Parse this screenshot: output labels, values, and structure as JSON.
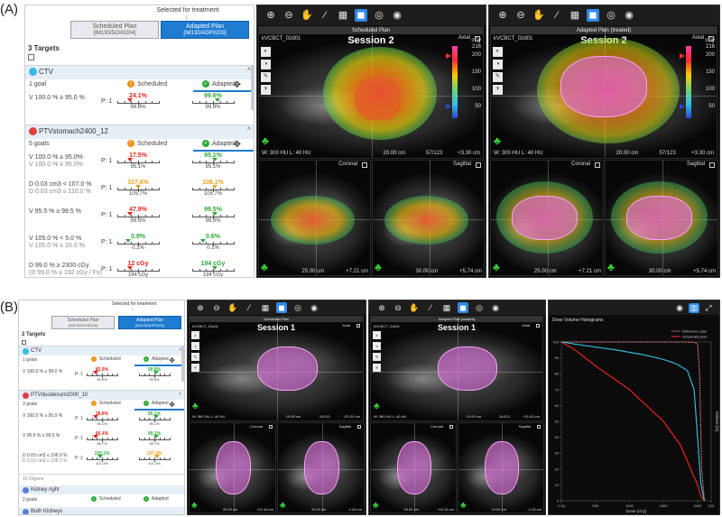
{
  "figureA": {
    "label": "(A)",
    "leftPanel": {
      "selectedCaption": "Selected for treatment",
      "scheduledPlan": {
        "label": "Scheduled Plan",
        "sub": "[IM130/5CH0204]"
      },
      "adaptedPlan": {
        "label": "Adapted Plan",
        "sub": "[IM130/ADP0203]"
      },
      "targetsHeader": "3 Targets",
      "ctv": {
        "title": "CTV",
        "goals": "1 goal",
        "scheduled": "Scheduled",
        "adapted": "Adapted",
        "rows": [
          {
            "label": "V 100.0 % ≥ 95.0 %",
            "sub": "",
            "p": "P: 1",
            "sVal": "24.1%",
            "sNum": "99.8%",
            "aVal": "99.6%",
            "aNum": "99.8%",
            "sColor": "#e0241b",
            "aColor": "#2eaa3a",
            "sFrac": 0.3,
            "aFrac": 0.6
          }
        ]
      },
      "ptv": {
        "title": "PTVstomach2400_12",
        "goals": "5 goals",
        "scheduled": "Scheduled",
        "adapted": "Adapted",
        "rows": [
          {
            "label": "V 100.0 % ≥ 95.0%",
            "sub": "V 100.0 % ≥ 95.0%",
            "p": "P: 1",
            "sVal": "17.5%",
            "sNum": "95.1%",
            "aVal": "95.1%",
            "aNum": "95.1%",
            "sColor": "#e0241b",
            "aColor": "#2eaa3a",
            "sFrac": 0.3,
            "aFrac": 0.55
          },
          {
            "label": "D 0.03 cm3 < 107.0 %",
            "sub": "D 0.03 cm3 ≤ 110.0 %",
            "p": "P: 1",
            "sVal": "107.6%",
            "sNum": "105.7%",
            "aVal": "108.1%",
            "aNum": "105.7%",
            "sColor": "#e6a21a",
            "aColor": "#e6a21a",
            "sFrac": 0.5,
            "aFrac": 0.55
          },
          {
            "label": "V 95.5 % ≥ 99.5 %",
            "sub": "",
            "p": "P: 1",
            "sVal": "47.9%",
            "sNum": "99.5%",
            "aVal": "99.5%",
            "aNum": "99.5%",
            "sColor": "#e0241b",
            "aColor": "#2eaa3a",
            "sFrac": 0.3,
            "aFrac": 0.55
          },
          {
            "label": "V 105.0 % < 5.0 %",
            "sub": "V 105.0 % ≤ 10.0 %",
            "p": "P: 1",
            "sVal": "0.9%",
            "sNum": "0.1%",
            "aVal": "0.6%",
            "aNum": "0.1%",
            "sColor": "#2eaa3a",
            "aColor": "#2eaa3a",
            "sFrac": 0.25,
            "aFrac": 0.25
          },
          {
            "label": "D 99.0 % ≥ 2300 cGy",
            "sub": "(D 99.0 % ≥ 192 cGy / Fx)",
            "p": "P: 1",
            "sVal": "12 cGy",
            "sNum": "194 cGy",
            "aVal": "194 cGy",
            "aNum": "194 cGy",
            "sColor": "#e0241b",
            "aColor": "#2eaa3a",
            "sFrac": 0.3,
            "aFrac": 0.55
          }
        ]
      }
    },
    "viewer1": {
      "axial": {
        "banner": "Scheduled Plan",
        "scanId": "kVCBCT_02d01",
        "session": "Session 2",
        "tag": "Axial",
        "unit": "cGy",
        "scaleTop": "216",
        "scaleTicks": [
          "200",
          "150",
          "100",
          "50"
        ],
        "wl": "W: 300 HU  L: 40 HU",
        "dist": "20.00 cm",
        "slice": "57/123",
        "z": "+3.30 cm"
      },
      "coronal": {
        "tag": "Coronal",
        "dist": "25.00 cm",
        "z": "+7.21 cm"
      },
      "sagittal": {
        "tag": "Sagittal",
        "dist": "30.00 cm",
        "z": "+5.74 cm"
      }
    },
    "viewer2": {
      "axial": {
        "banner": "Adapted Plan (treated)",
        "scanId": "kVCBCT_02d01",
        "session": "Session 2",
        "tag": "Axial",
        "unit": "cGy",
        "scaleTop": "216",
        "scaleTicks": [
          "200",
          "150",
          "100",
          "50"
        ],
        "wl": "W: 300 HU  L: 40 HU",
        "dist": "20.00 cm",
        "slice": "57/123",
        "z": "+3.30 cm"
      },
      "coronal": {
        "tag": "Coronal",
        "dist": "25.00 cm",
        "z": "+7.21 cm"
      },
      "sagittal": {
        "tag": "Sagittal",
        "dist": "30.00 cm",
        "z": "+5.74 cm"
      }
    },
    "toolbarIcons": [
      "zoom-in-icon",
      "zoom-out-icon",
      "hand-icon",
      "ruler-icon",
      "grid-icon",
      "window-icon",
      "contour-icon",
      "target-icon"
    ]
  },
  "figureB": {
    "label": "(B)",
    "leftPanel": {
      "selectedCaption": "Selected for treatment",
      "scheduledPlan": {
        "label": "Scheduled Plan",
        "sub": "[IM175/SCH0104]"
      },
      "adaptedPlan": {
        "label": "Adapted Plan",
        "sub": "[IM175/ADP0103]"
      },
      "targetsHeader": "2 Targets",
      "ctv": {
        "title": "CTV",
        "goals": "1 goals",
        "scheduled": "Scheduled",
        "adapted": "Adapted",
        "rows": [
          {
            "label": "V 100.0 % ≥ 99.0 %",
            "sub": "",
            "p": "P: 1",
            "sVal": "82.9%",
            "sNum": "99.5%",
            "aVal": "99.8%",
            "aNum": "99.5%",
            "sColor": "#e0241b",
            "aColor": "#2eaa3a",
            "sFrac": 0.3,
            "aFrac": 0.55
          }
        ]
      },
      "ptv": {
        "title": "PTVduodenum2000_10",
        "goals": "3 goals",
        "scheduled": "Scheduled",
        "adapted": "Adapted",
        "rows": [
          {
            "label": "V 100.0 % ≥ 95.0 %",
            "sub": "",
            "p": "P: 1",
            "sVal": "38.8%",
            "sNum": "95.1%",
            "aVal": "95.1%",
            "aNum": "95.1%",
            "sColor": "#e0241b",
            "aColor": "#2eaa3a",
            "sFrac": 0.3,
            "aFrac": 0.55
          },
          {
            "label": "V 95.0 % ≥ 99.0 %",
            "sub": "",
            "p": "P: 1",
            "sVal": "66.4%",
            "sNum": "98.7%",
            "aVal": "99.1%",
            "aNum": "98.7%",
            "sColor": "#e0241b",
            "aColor": "#2eaa3a",
            "sFrac": 0.3,
            "aFrac": 0.55
          },
          {
            "label": "D 0.03 cm3 ≤ 106.0 %",
            "sub": "D 0.03 cm3 ≤ 108.0 %",
            "p": "P: 1",
            "sVal": "105.1%",
            "sNum": "107.4%",
            "aVal": "107.4%",
            "aNum": "107.4%",
            "sColor": "#2eaa3a",
            "aColor": "#e6a21a",
            "sFrac": 0.45,
            "aFrac": 0.6
          }
        ]
      },
      "organsHeader": "15 Organs",
      "kidney": {
        "title": "Kidney right",
        "goals": "2 goals",
        "scheduled": "Scheduled",
        "adapted": "Adapted"
      },
      "bothKidneys": "Both Kidneys"
    },
    "viewer1": {
      "axial": {
        "banner": "Scheduled Plan",
        "scanId": "kVCBCT_01a01",
        "session": "Session 1",
        "tag": "Axial",
        "wl": "W: 360 HU  L: 40 HU",
        "dist": "10.00 cm",
        "slice": "34/113",
        "z": "+21.00 cm"
      },
      "coronal": {
        "tag": "Coronal",
        "dist": "20.00 cm",
        "z": "+10.16 cm"
      },
      "sagittal": {
        "tag": "Sagittal",
        "dist": "10.00 cm",
        "z": "-1.26 cm"
      }
    },
    "viewer2": {
      "axial": {
        "banner": "Adapted Plan (treated)",
        "scanId": "kVCBCT_01a01",
        "session": "Session 1",
        "tag": "Axial",
        "wl": "W: 360 HU  L: 40 HU",
        "dist": "10.00 cm",
        "slice": "34/113",
        "z": "+21.00 cm"
      },
      "coronal": {
        "tag": "Coronal",
        "dist": "20.00 cm",
        "z": "+10.16 cm"
      },
      "sagittal": {
        "tag": "Sagittal",
        "dist": "10.00 cm",
        "z": "-1.26 cm"
      }
    },
    "dvh": {
      "title": "Dose Volume Histograms"
    }
  },
  "chart_data": {
    "type": "line",
    "title": "Dose Volume Histograms",
    "xlabel": "Dose [cGy]",
    "ylabel": "Volume [%]",
    "xlim": [
      0,
      2200
    ],
    "ylim": [
      0,
      100
    ],
    "x_ticks": [
      "0 Gy",
      "500",
      "1000",
      "1500",
      "2000",
      "220"
    ],
    "y_ticks": [
      "0",
      "10",
      "20",
      "30",
      "40",
      "50",
      "60",
      "70",
      "80",
      "90",
      "100"
    ],
    "legend": [
      "Reference plan",
      "Scheduled plan"
    ],
    "legend_position": "top-right",
    "series": [
      {
        "name": "Reference plan",
        "color": "#ff8a8a",
        "style": "dotted",
        "x": [
          0,
          1800,
          1950,
          2000,
          2030,
          2060,
          2100
        ],
        "y": [
          100,
          100,
          99.8,
          99,
          80,
          20,
          0
        ]
      },
      {
        "name": "Scheduled plan",
        "color": "#ff2424",
        "style": "solid",
        "x": [
          0,
          200,
          500,
          800,
          1000,
          1200,
          1500,
          1750,
          1900,
          2000,
          2050,
          2100
        ],
        "y": [
          100,
          95,
          85,
          76,
          70,
          62,
          50,
          35,
          20,
          10,
          3,
          0
        ]
      },
      {
        "color": "#35c6e6",
        "style": "solid",
        "x": [
          0,
          300,
          800,
          1200,
          1500,
          1700,
          1850,
          1950,
          2000,
          2050,
          2100
        ],
        "y": [
          100,
          98,
          95,
          92,
          89,
          86,
          82,
          70,
          40,
          10,
          0
        ]
      }
    ]
  }
}
